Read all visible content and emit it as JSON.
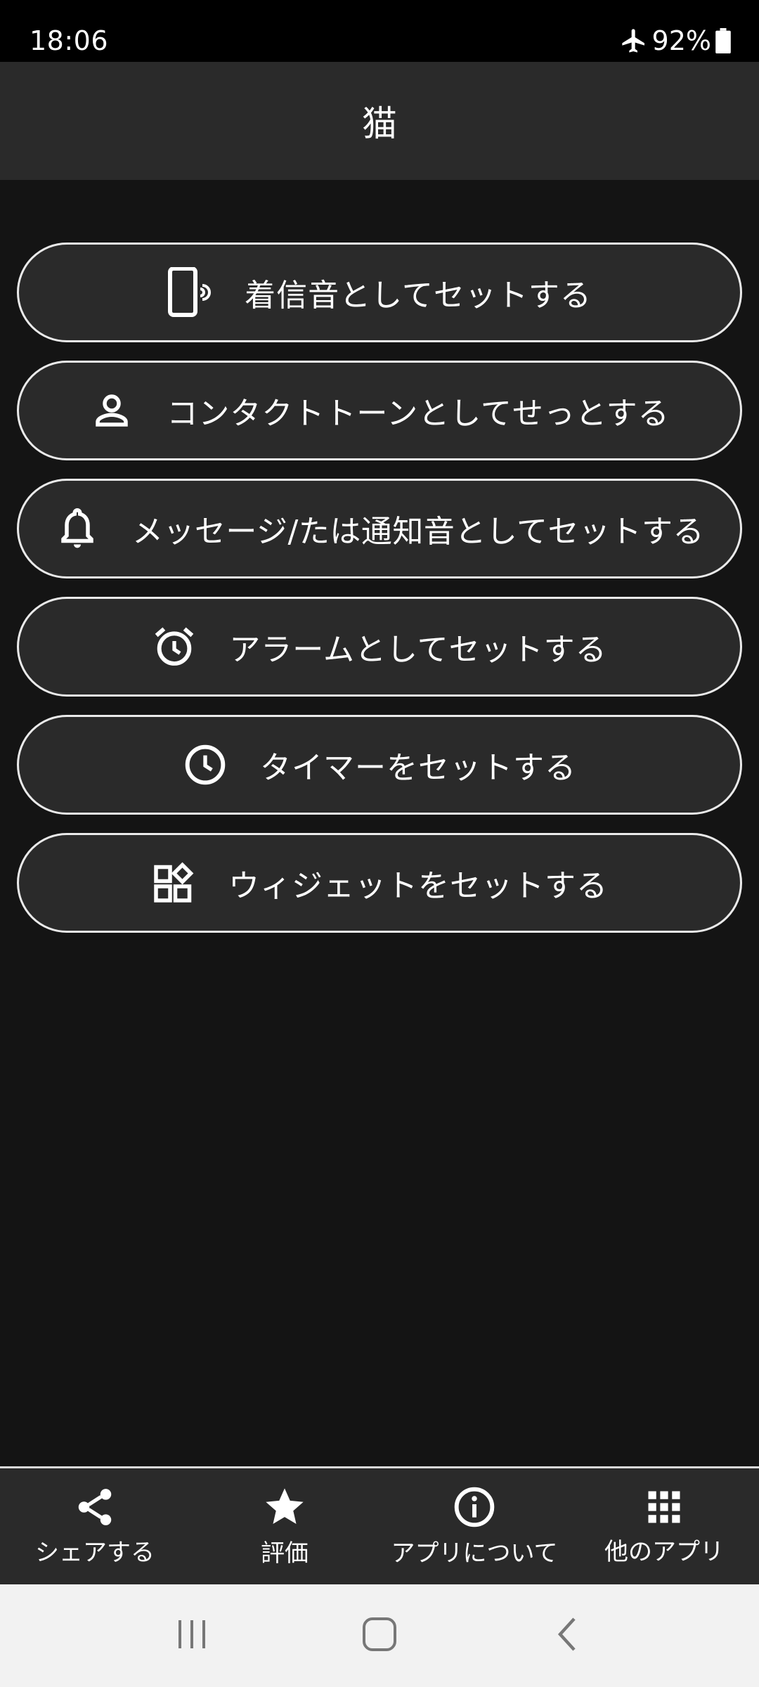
{
  "status_bar": {
    "time": "18:06",
    "battery": "92%",
    "icons": [
      "airplane-icon",
      "battery-icon"
    ]
  },
  "app_bar": {
    "title": "猫"
  },
  "actions": [
    {
      "label": "着信音としてセットする",
      "icon": "phone-ring-icon"
    },
    {
      "label": "コンタクトトーンとしてせっとする",
      "icon": "person-icon"
    },
    {
      "label": "メッセージ/たは通知音としてセットする",
      "icon": "bell-icon"
    },
    {
      "label": "アラームとしてセットする",
      "icon": "alarm-clock-icon"
    },
    {
      "label": "タイマーをセットする",
      "icon": "clock-icon"
    },
    {
      "label": "ウィジェットをセットする",
      "icon": "widgets-icon"
    }
  ],
  "bottom_nav": [
    {
      "label": "シェアする",
      "icon": "share-icon"
    },
    {
      "label": "評価",
      "icon": "star-icon"
    },
    {
      "label": "アプリについて",
      "icon": "info-icon"
    },
    {
      "label": "他のアプリ",
      "icon": "grid-icon"
    }
  ],
  "system_nav": [
    "recent-apps-icon",
    "home-icon",
    "back-icon"
  ],
  "colors": {
    "background": "#141414",
    "app_bar": "#2a2a2a",
    "button_fill": "#2a2a2a",
    "button_border": "#eaeaea",
    "text": "#ffffff",
    "system_nav_bg": "#f2f2f2",
    "system_nav_icon": "#777777"
  }
}
